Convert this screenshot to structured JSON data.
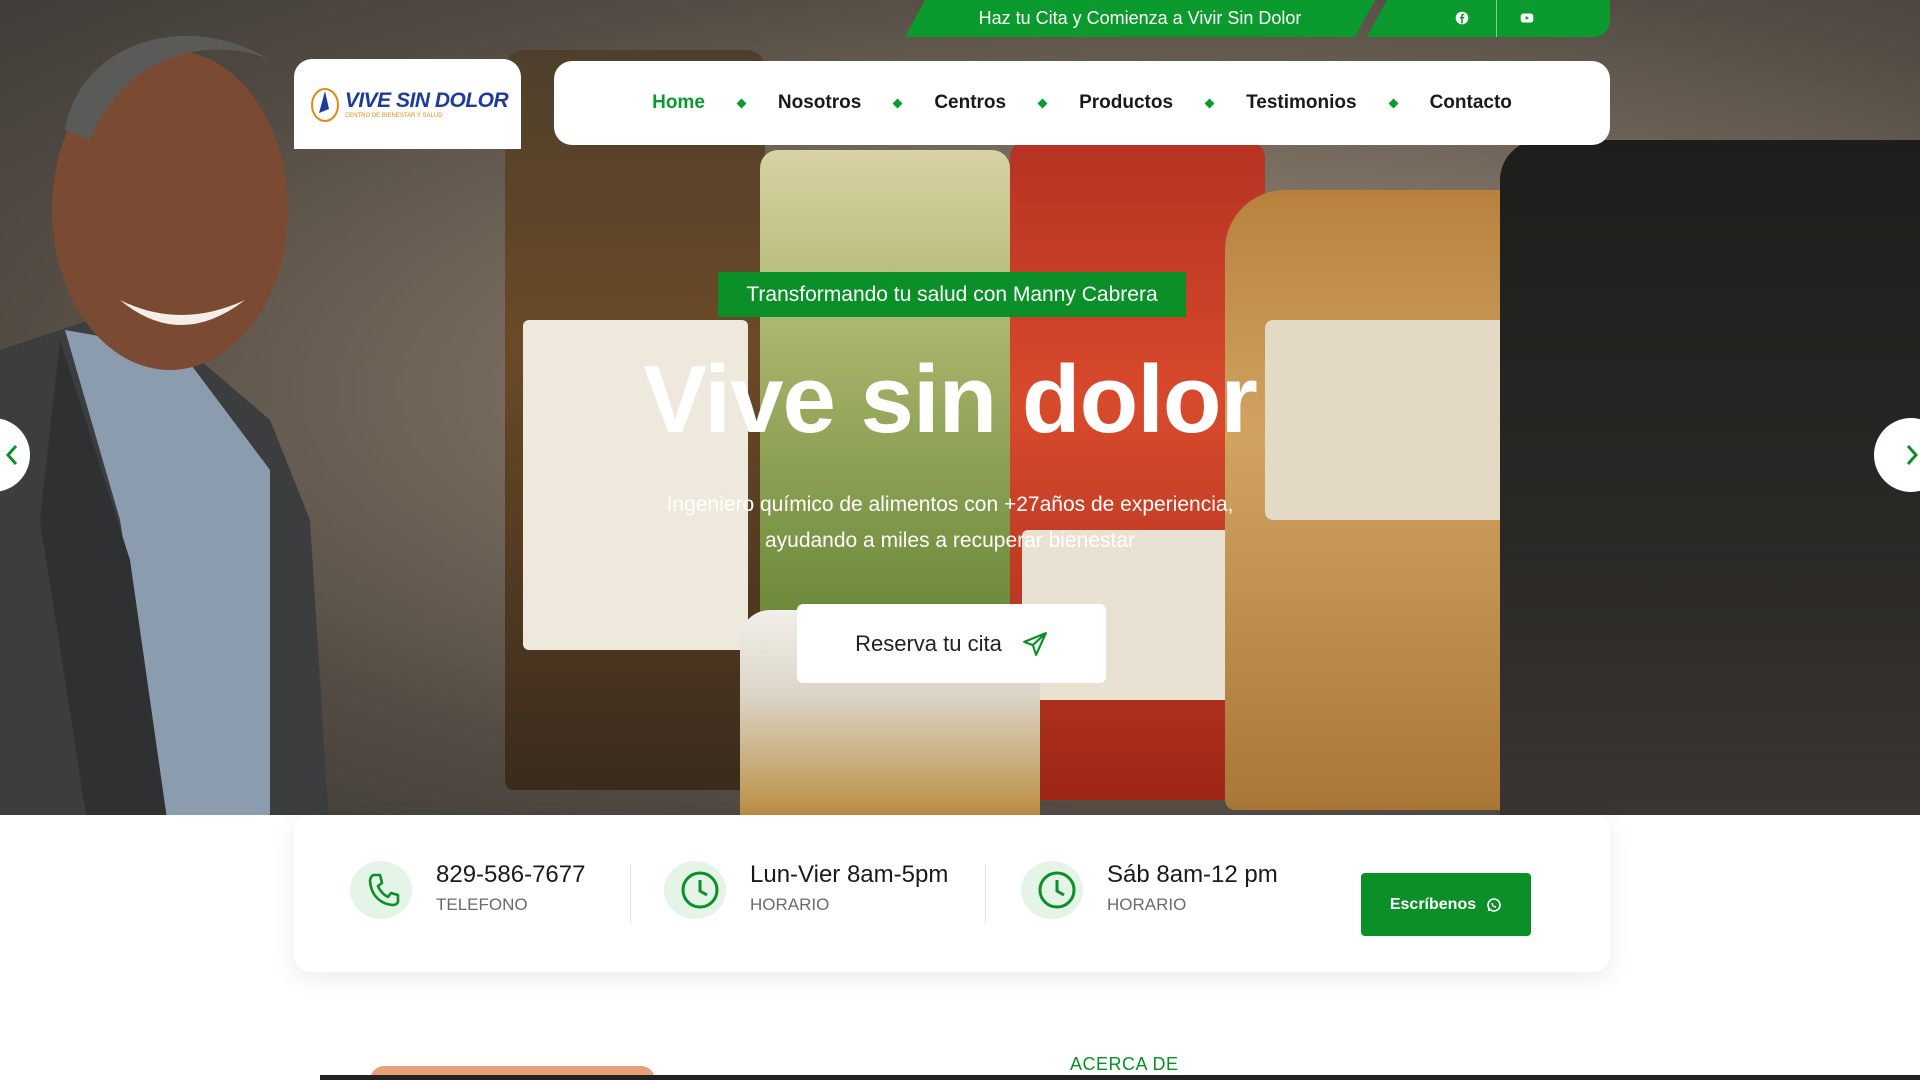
{
  "topbar": {
    "promo_text": "Haz tu Cita y Comienza a Vivir Sin Dolor",
    "icons": [
      "facebook-icon",
      "youtube-icon"
    ]
  },
  "logo": {
    "brand_text": "VIVE SIN DOLOR",
    "tagline": "CENTRO DE BIENESTAR Y SALUD"
  },
  "nav": {
    "items": [
      {
        "label": "Home",
        "active": true
      },
      {
        "label": "Nosotros"
      },
      {
        "label": "Centros"
      },
      {
        "label": "Productos"
      },
      {
        "label": "Testimonios"
      },
      {
        "label": "Contacto"
      }
    ]
  },
  "hero": {
    "tag": "Transformando tu salud con Manny Cabrera",
    "title": "Vive sin dolor",
    "subtitle_line1": "Ingeniero químico de alimentos con +27años de experiencia,",
    "subtitle_line2": "ayudando a miles a recuperar bienestar",
    "cta_label": "Reserva tu cita"
  },
  "info_bar": {
    "phone": {
      "value": "829-586-7677",
      "label": "TELEFONO"
    },
    "weekday": {
      "value": "Lun-Vier 8am-5pm",
      "label": "HORARIO"
    },
    "saturday": {
      "value": "Sáb 8am-12 pm",
      "label": "HORARIO"
    },
    "write_button": "Escríbenos"
  },
  "about": {
    "eyebrow": "ACERCA DE"
  },
  "colors": {
    "brand_green": "#0b9a2d",
    "dark_green": "#0b8f28",
    "logo_blue": "#1f3a9a"
  }
}
